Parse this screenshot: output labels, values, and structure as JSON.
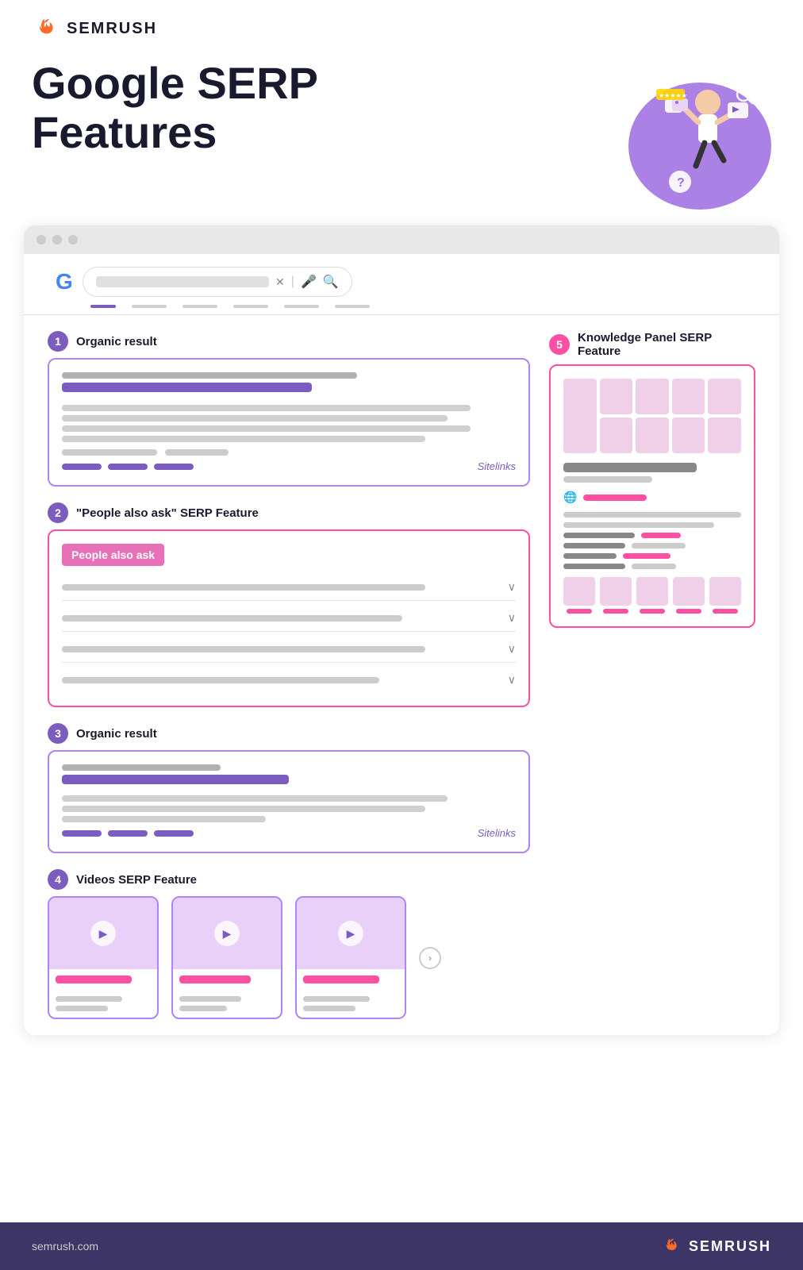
{
  "brand": {
    "name": "SEMRUSH",
    "url": "semrush.com"
  },
  "hero": {
    "title": "Google SERP Features"
  },
  "browser": {
    "search_placeholder": ""
  },
  "nav_tabs": [
    "active",
    "inactive",
    "inactive",
    "inactive",
    "inactive",
    "inactive"
  ],
  "sections": {
    "section1": {
      "number": "1",
      "title": "Organic result",
      "sitelinks_label": "Sitelinks"
    },
    "section2": {
      "number": "2",
      "title": "\"People  also ask\" SERP Feature",
      "paa_header": "People also ask"
    },
    "section3": {
      "number": "3",
      "title": "Organic result",
      "sitelinks_label": "Sitelinks"
    },
    "section4": {
      "number": "4",
      "title": "Videos SERP Feature"
    },
    "section5": {
      "number": "5",
      "title": "Knowledge Panel SERP Feature"
    }
  },
  "footer": {
    "url": "semrush.com",
    "brand": "SEMRUSH"
  }
}
